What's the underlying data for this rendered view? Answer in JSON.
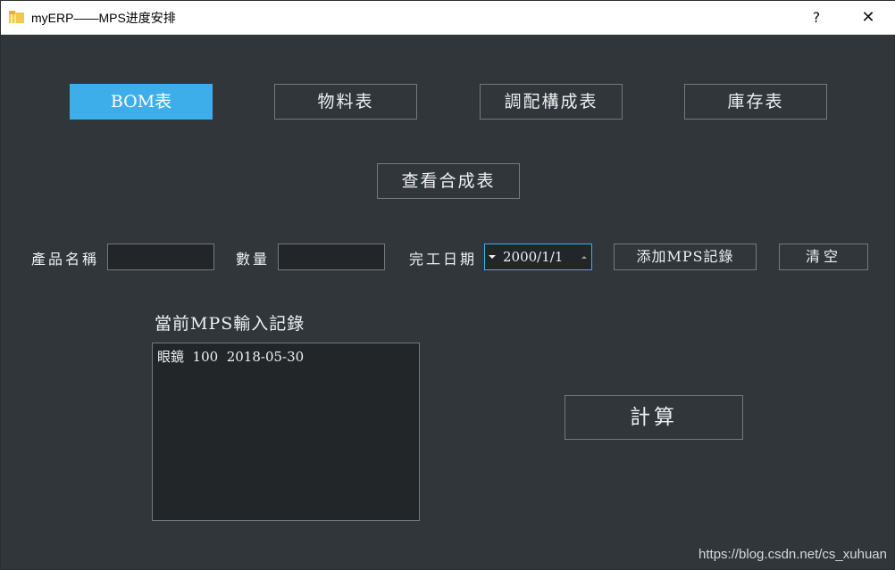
{
  "window": {
    "title": "myERP——MPS进度安排",
    "help_label": "?",
    "close_label": "✕"
  },
  "toolbar": {
    "bom_label": "BOM表",
    "material_label": "物料表",
    "allocation_label": "調配構成表",
    "inventory_label": "庫存表",
    "composite_label": "查看合成表"
  },
  "form": {
    "product_name_label": "產品名稱",
    "product_name_value": "",
    "quantity_label": "數量",
    "quantity_value": "",
    "due_date_label": "完工日期",
    "due_date_value": "2000/1/1",
    "add_label": "添加MPS記錄",
    "clear_label": "清空"
  },
  "records": {
    "heading": "當前MPS輸入記錄",
    "items": [
      "眼鏡  100  2018-05-30"
    ]
  },
  "calculate_label": "計算",
  "watermark": "https://blog.csdn.net/cs_xuhuan",
  "colors": {
    "background": "#31363b",
    "accent": "#3daee9",
    "field_bg": "#232629",
    "border": "#76797c",
    "text": "#eff0f1"
  }
}
